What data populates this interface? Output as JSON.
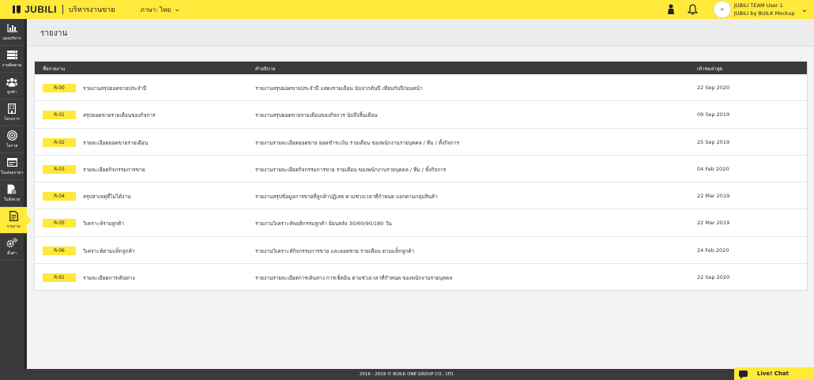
{
  "topbar": {
    "brand": "JUBILI",
    "service_title": "บริหารงานขาย",
    "language": "ภาษา: ไทย",
    "user_name": "JUBILI TEAM User 1",
    "company": "JUBILI by BUILK Mockup"
  },
  "sidebar": {
    "items": [
      {
        "label": "แผงบริหาร",
        "icon": "chart-icon"
      },
      {
        "label": "งานติดตาม",
        "icon": "server-icon"
      },
      {
        "label": "ลูกค้า",
        "icon": "users-icon"
      },
      {
        "label": "โครงการ",
        "icon": "building-icon"
      },
      {
        "label": "โอกาส",
        "icon": "target-icon"
      },
      {
        "label": "ใบเสนอราคา",
        "icon": "invoice-icon"
      },
      {
        "label": "ใบสั่งขาย",
        "icon": "order-icon"
      },
      {
        "label": "รายงาน",
        "icon": "report-icon"
      },
      {
        "label": "ตั้งค่า",
        "icon": "settings-icon"
      }
    ]
  },
  "page": {
    "title": "รายงาน"
  },
  "table": {
    "headers": {
      "name": "ชื่อรายงาน",
      "desc": "คำอธิบาย",
      "date": "เข้าชมล่าสุด"
    },
    "rows": [
      {
        "code": "R-00",
        "name": "รายงานสรุปยอดขายประจำปี",
        "desc": "รายงานสรุปยอดขายประจำปี แสดงรายเดือน นับจากต้นปี เทียบกับปีก่อนหน้า",
        "date": "22 Sep 2020"
      },
      {
        "code": "R-01",
        "name": "สรุปยอดขายรายเดือนของกิจการ",
        "desc": "รายงานสรุปยอดขายรายเดือนของกิจการ นับถึงสิ้นเดือน",
        "date": "09 Sep 2019"
      },
      {
        "code": "R-02",
        "name": "รายละเอียดยอดขายรายเดือน",
        "desc": "รายงานรายละเอียดยอดขาย ยอดชำระเงิน รายเดือน ของพนักงานรายบุคคล / ทีม / ทั้งกิจการ",
        "date": "25 Sep 2019"
      },
      {
        "code": "R-03",
        "name": "รายละเอียดกิจกรรมการขาย",
        "desc": "รายงานรายละเอียดกิจกรรมการขาย รายเดือน ของพนักงานรายบุคคล / ทีม / ทั้งกิจการ",
        "date": "04 Feb 2020"
      },
      {
        "code": "R-04",
        "name": "สรุปสาเหตุที่ไม่ได้งาน",
        "desc": "รายงานสรุปข้อมูลการขายที่ลูกค้าปฏิเสธ ตามช่วงเวลาที่กำหนด แยกตามกลุ่มสินค้า",
        "date": "22 Mar 2019"
      },
      {
        "code": "R-05",
        "name": "วิเคราะห์รายลูกค้า",
        "desc": "รายงานวิเคราะห์พฤติกรรมลูกค้า ย้อนหลัง 30/60/90/180 วัน",
        "date": "22 Mar 2019"
      },
      {
        "code": "R-06",
        "name": "วิเคราะห์ตามแท็กลูกค้า",
        "desc": "รายงานวิเคราะห์กิจกรรมการขาย และยอดขาย รายเดือน ตามแท็กลูกค้า",
        "date": "24 Feb 2020"
      },
      {
        "code": "R-91",
        "name": "รายละเอียดการเดินทาง",
        "desc": "รายงานรายละเอียดการเดินทาง การเช็คอิน ตามช่วงเวลาที่กำหนด ของพนักงานรายบุคคล",
        "date": "22 Sep 2020"
      }
    ]
  },
  "footer": {
    "copyright": "2016 - 2019 © BUILK ONE GROUP CO., LTD."
  },
  "livechat": {
    "label": "Live! Chat"
  },
  "colors": {
    "accent": "#ffe93a",
    "dark": "#3a3a3a"
  }
}
